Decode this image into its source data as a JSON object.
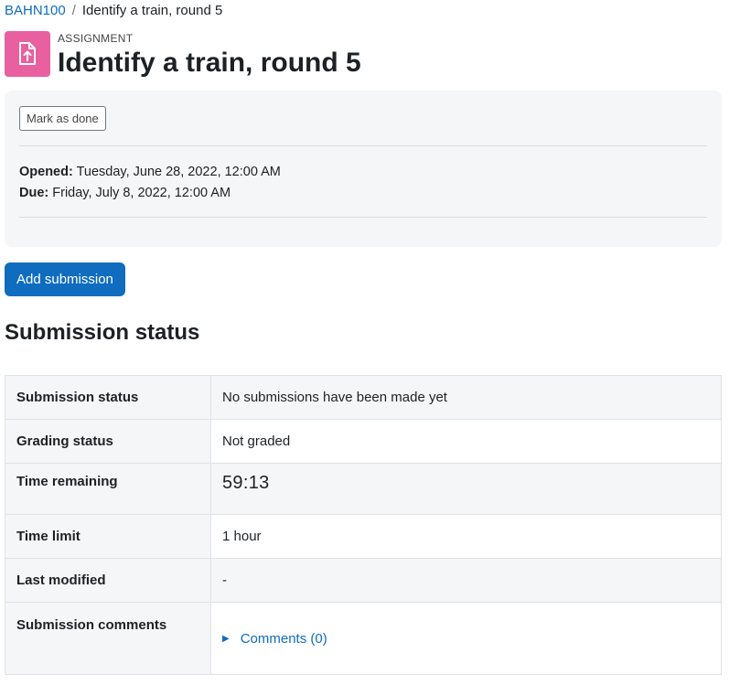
{
  "breadcrumb": {
    "course": "BAHN100",
    "separator": "/",
    "current": "Identify a train, round 5"
  },
  "header": {
    "activity_type": "ASSIGNMENT",
    "title": "Identify a train, round 5",
    "icon": "assignment-upload-icon",
    "icon_color": "#e8609f"
  },
  "dates": {
    "mark_done_label": "Mark as done",
    "opened_label": "Opened:",
    "opened_value": "Tuesday, June 28, 2022, 12:00 AM",
    "due_label": "Due:",
    "due_value": "Friday, July 8, 2022, 12:00 AM"
  },
  "actions": {
    "add_submission_label": "Add submission",
    "primary_color": "#0f6cbf"
  },
  "submission_status": {
    "title": "Submission status",
    "rows": [
      {
        "label": "Submission status",
        "value": "No submissions have been made yet"
      },
      {
        "label": "Grading status",
        "value": "Not graded"
      },
      {
        "label": "Time remaining",
        "value": "59:13"
      },
      {
        "label": "Time limit",
        "value": "1 hour"
      },
      {
        "label": "Last modified",
        "value": "-"
      },
      {
        "label": "Submission comments",
        "value": "Comments (0)"
      }
    ]
  }
}
